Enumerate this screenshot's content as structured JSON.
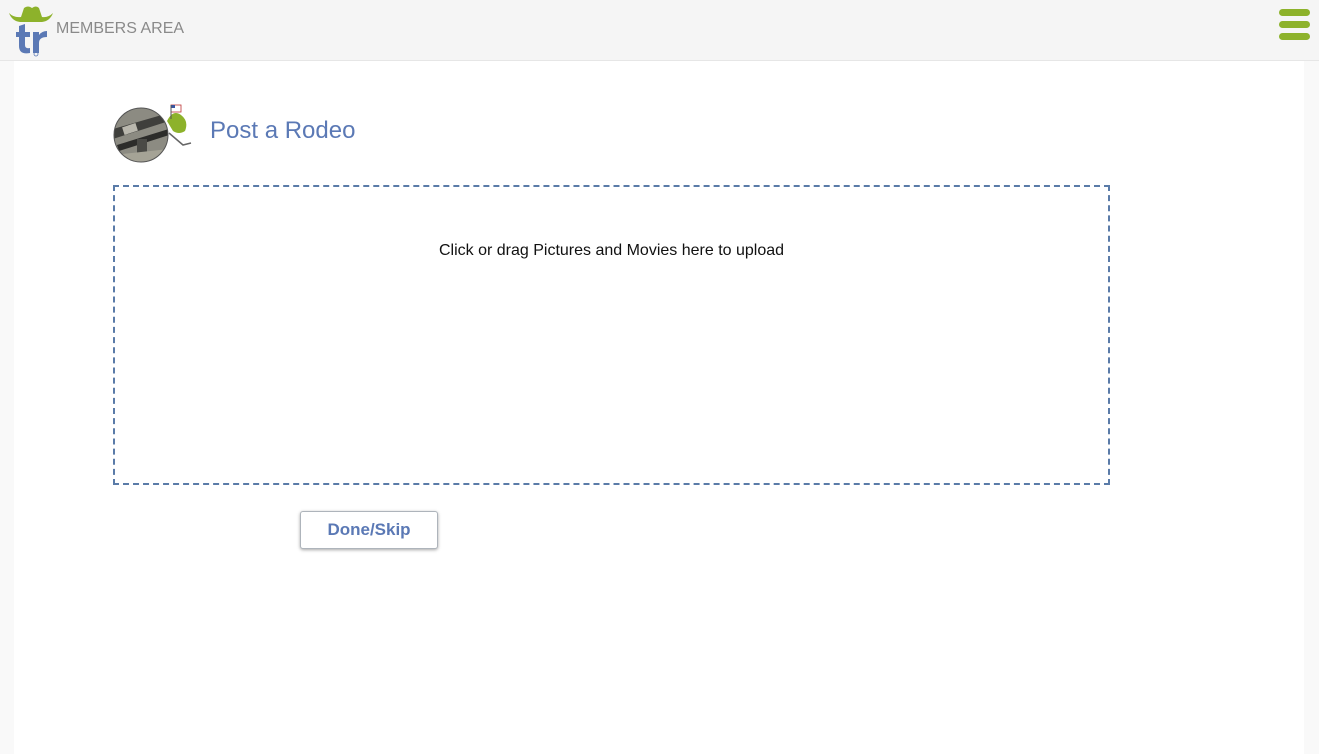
{
  "header": {
    "section_label": "MEMBERS AREA",
    "logo_icon": "tr-cowboy-hat-logo-icon",
    "menu_icon": "hamburger-menu-icon"
  },
  "main": {
    "avatar_icon": "rifle-rodeo-avatar-icon",
    "title": "Post a Rodeo",
    "upload_prompt": "Click or drag Pictures and Movies here to upload",
    "done_label": "Done/Skip"
  },
  "colors": {
    "accent_green": "#8db22b",
    "brand_blue": "#5b79b5",
    "dropzone_border": "#5a7ba8"
  }
}
